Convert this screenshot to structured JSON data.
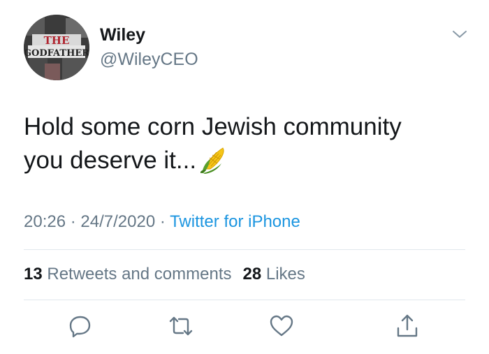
{
  "tweet": {
    "author_name": "Wiley",
    "author_handle": "@WileyCEO",
    "avatar_text_line1": "THE",
    "avatar_text_line2": "GODFATHER",
    "text_line1": "Hold some corn Jewish community",
    "text_line2": "you deserve it...",
    "emoji": "corn-emoji",
    "time": "20:26",
    "date": "24/7/2020",
    "separator": "·",
    "source": "Twitter for iPhone"
  },
  "stats": {
    "retweets_count": "13",
    "retweets_label": "Retweets and comments",
    "likes_count": "28",
    "likes_label": "Likes"
  },
  "actions": [
    {
      "icon": "reply-icon"
    },
    {
      "icon": "retweet-icon"
    },
    {
      "icon": "like-icon"
    },
    {
      "icon": "share-icon"
    }
  ],
  "colors": {
    "primary_text": "#14171a",
    "secondary_text": "#657786",
    "link": "#1b95e0",
    "divider": "#e1e8ed"
  }
}
